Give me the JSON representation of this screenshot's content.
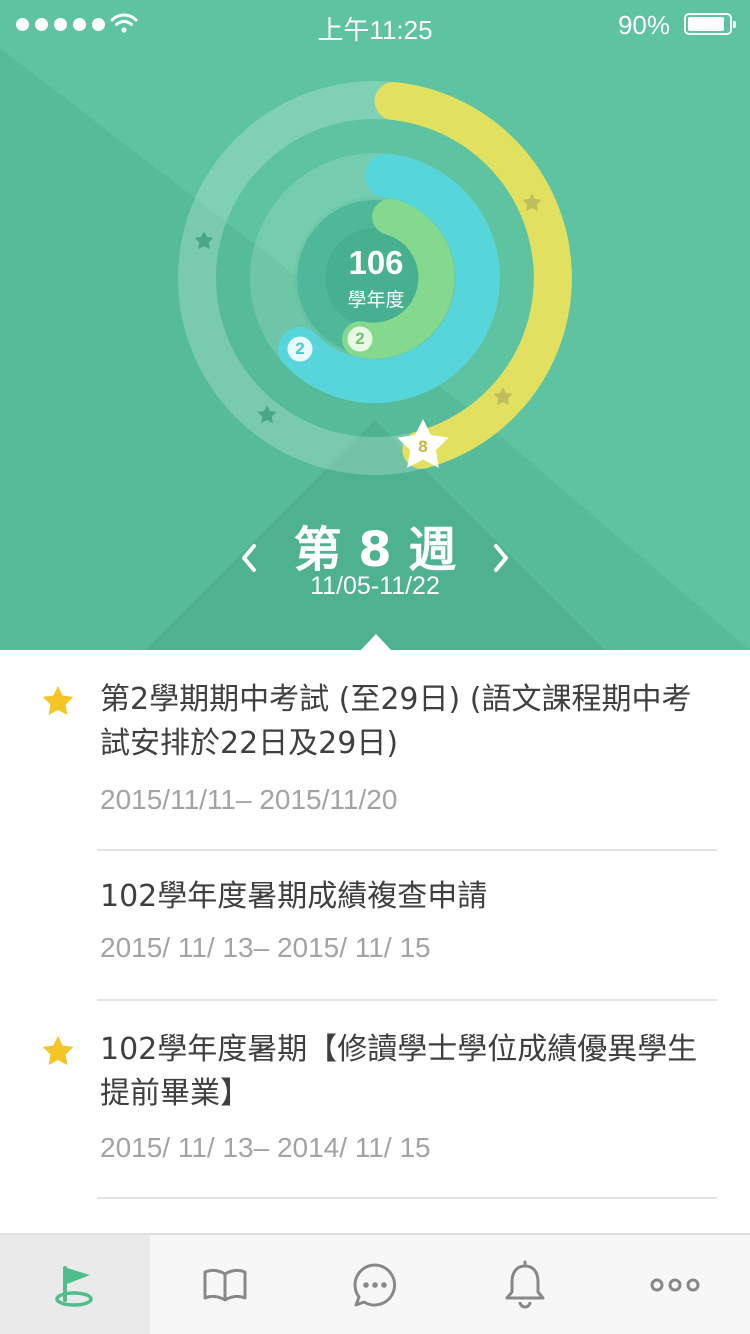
{
  "status_bar": {
    "time": "上午11:25",
    "battery_percent_text": "90%",
    "battery_level": 0.9,
    "icons": [
      "signal-dots",
      "wifi-icon",
      "battery-icon"
    ]
  },
  "rings": {
    "academic_year": "106",
    "academic_year_label": "學年度",
    "outer_badge": "8",
    "middle_badge": "2",
    "inner_badge": "2",
    "colors": {
      "outer": "#e2e15f",
      "middle": "#56d6db",
      "inner": "#85d98f",
      "background": "#5dc3a0"
    }
  },
  "week": {
    "title": "第 8 週",
    "range": "11/05-11/22",
    "prev_icon": "chevron-left-icon",
    "next_icon": "chevron-right-icon"
  },
  "events": [
    {
      "starred": true,
      "title": "第2學期期中考試 (至29日) (語文課程期中考試安排於22日及29日)",
      "date": "2015/11/11– 2015/11/20"
    },
    {
      "starred": false,
      "title": "102學年度暑期成績複查申請",
      "date": "2015/ 11/ 13– 2015/ 11/ 15"
    },
    {
      "starred": true,
      "title": "102學年度暑期【修讀學士學位成績優異學生提前畢業】",
      "date": "2015/ 11/ 13– 2014/ 11/ 15"
    }
  ],
  "tabbar": {
    "active": "flag-icon",
    "tabs": [
      "flag-icon",
      "book-icon",
      "chat-icon",
      "bell-icon",
      "more-icon"
    ],
    "active_color": "#4cbf8c"
  }
}
